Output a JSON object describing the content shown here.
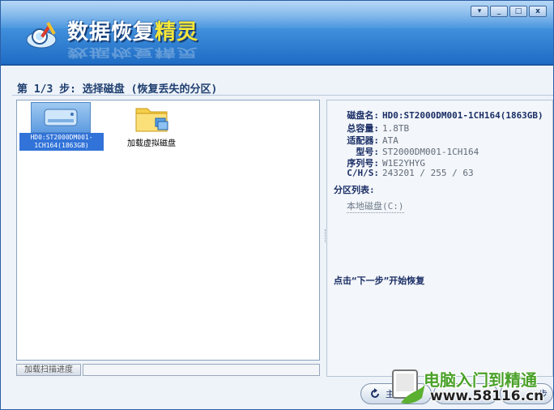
{
  "app": {
    "title_main": "数据恢复",
    "title_accent": "精灵"
  },
  "window_controls": {
    "menu": "▾",
    "minimize": "_",
    "maximize": "□",
    "close": "x"
  },
  "step": {
    "title": "第 1/3 步: 选择磁盘 (恢复丢失的分区)"
  },
  "disks": [
    {
      "label": "HD0:ST2000DM001-1CH164(1863GB)",
      "selected": true
    },
    {
      "label": "加载虚拟磁盘",
      "selected": false
    }
  ],
  "scan": {
    "label": "加载扫描进度"
  },
  "details": {
    "rows": [
      {
        "key": "磁盘名:",
        "value": "HD0:ST2000DM001-1CH164(1863GB)",
        "strong": true
      },
      {
        "key": "总容量:",
        "value": "1.8TB"
      },
      {
        "key": "适配器:",
        "value": "ATA"
      },
      {
        "key": "型号:",
        "value": "ST2000DM001-1CH164"
      },
      {
        "key": "序列号:",
        "value": "W1E2YHYG"
      },
      {
        "key": "C/H/S:",
        "value": "243201 / 255 / 63"
      }
    ],
    "partition_header": "分区列表:",
    "partitions": [
      "本地磁盘(C:)"
    ],
    "hint": "点击“下一步”开始恢复"
  },
  "footer": {
    "btn1": "主",
    "btn2": "一步"
  },
  "watermark": {
    "line1": "电脑入门到精通",
    "line2": "www.58116.cn"
  },
  "colors": {
    "accent": "#3173d8",
    "header": "#3f8fdc",
    "title_accent": "#f5e63a"
  }
}
